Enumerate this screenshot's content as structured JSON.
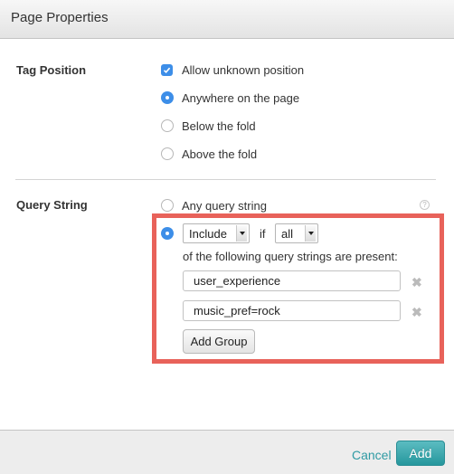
{
  "dialog": {
    "title": "Page Properties"
  },
  "tag_position": {
    "label": "Tag Position",
    "allow_unknown": {
      "label": "Allow unknown position",
      "checked": true
    },
    "options": [
      {
        "label": "Anywhere on the page",
        "selected": true
      },
      {
        "label": "Below the fold",
        "selected": false
      },
      {
        "label": "Above the fold",
        "selected": false
      }
    ]
  },
  "query_string": {
    "label": "Query String",
    "any_option": {
      "label": "Any query string",
      "selected": false
    },
    "help_icon": "?",
    "custom_option": {
      "selected": true,
      "mode_select": {
        "value": "Include"
      },
      "if_label": "if",
      "match_select": {
        "value": "all"
      },
      "description": "of the following query strings are present:",
      "entries": [
        {
          "value": "user_experience"
        },
        {
          "value": "music_pref=rock"
        }
      ],
      "remove_glyph": "✖",
      "add_group_label": "Add Group"
    },
    "highlight_color": "#e8625a"
  },
  "footer": {
    "cancel_label": "Cancel",
    "add_label": "Add",
    "accent_color": "#2f9aa3"
  }
}
